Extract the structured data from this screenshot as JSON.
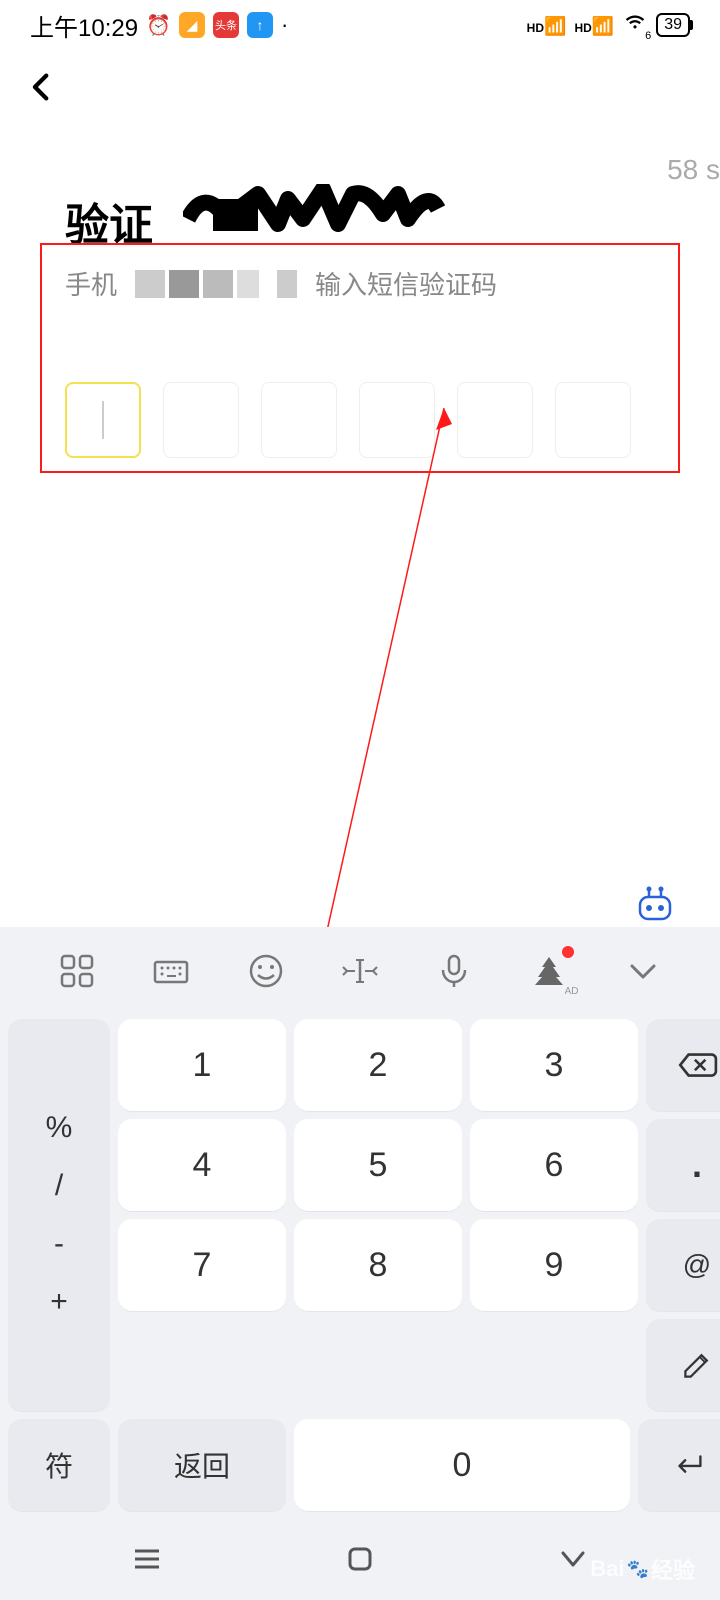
{
  "statusBar": {
    "time": "上午10:29",
    "battery": "39"
  },
  "page": {
    "titlePrefix": "验证",
    "countdown": "58 s",
    "phoneLabel": "手机",
    "placeholder": "输入短信验证码"
  },
  "keyboard": {
    "symbols": [
      "%",
      "/",
      "-",
      "+"
    ],
    "numbers": [
      [
        "1",
        "2",
        "3"
      ],
      [
        "4",
        "5",
        "6"
      ],
      [
        "7",
        "8",
        "9"
      ]
    ],
    "rightKeys": [
      "⌫",
      ".",
      "@"
    ],
    "bottomSym": "符",
    "bottomReturn": "返回",
    "zero": "0"
  },
  "watermark": {
    "text": "Bai",
    "suffix": "经验"
  }
}
